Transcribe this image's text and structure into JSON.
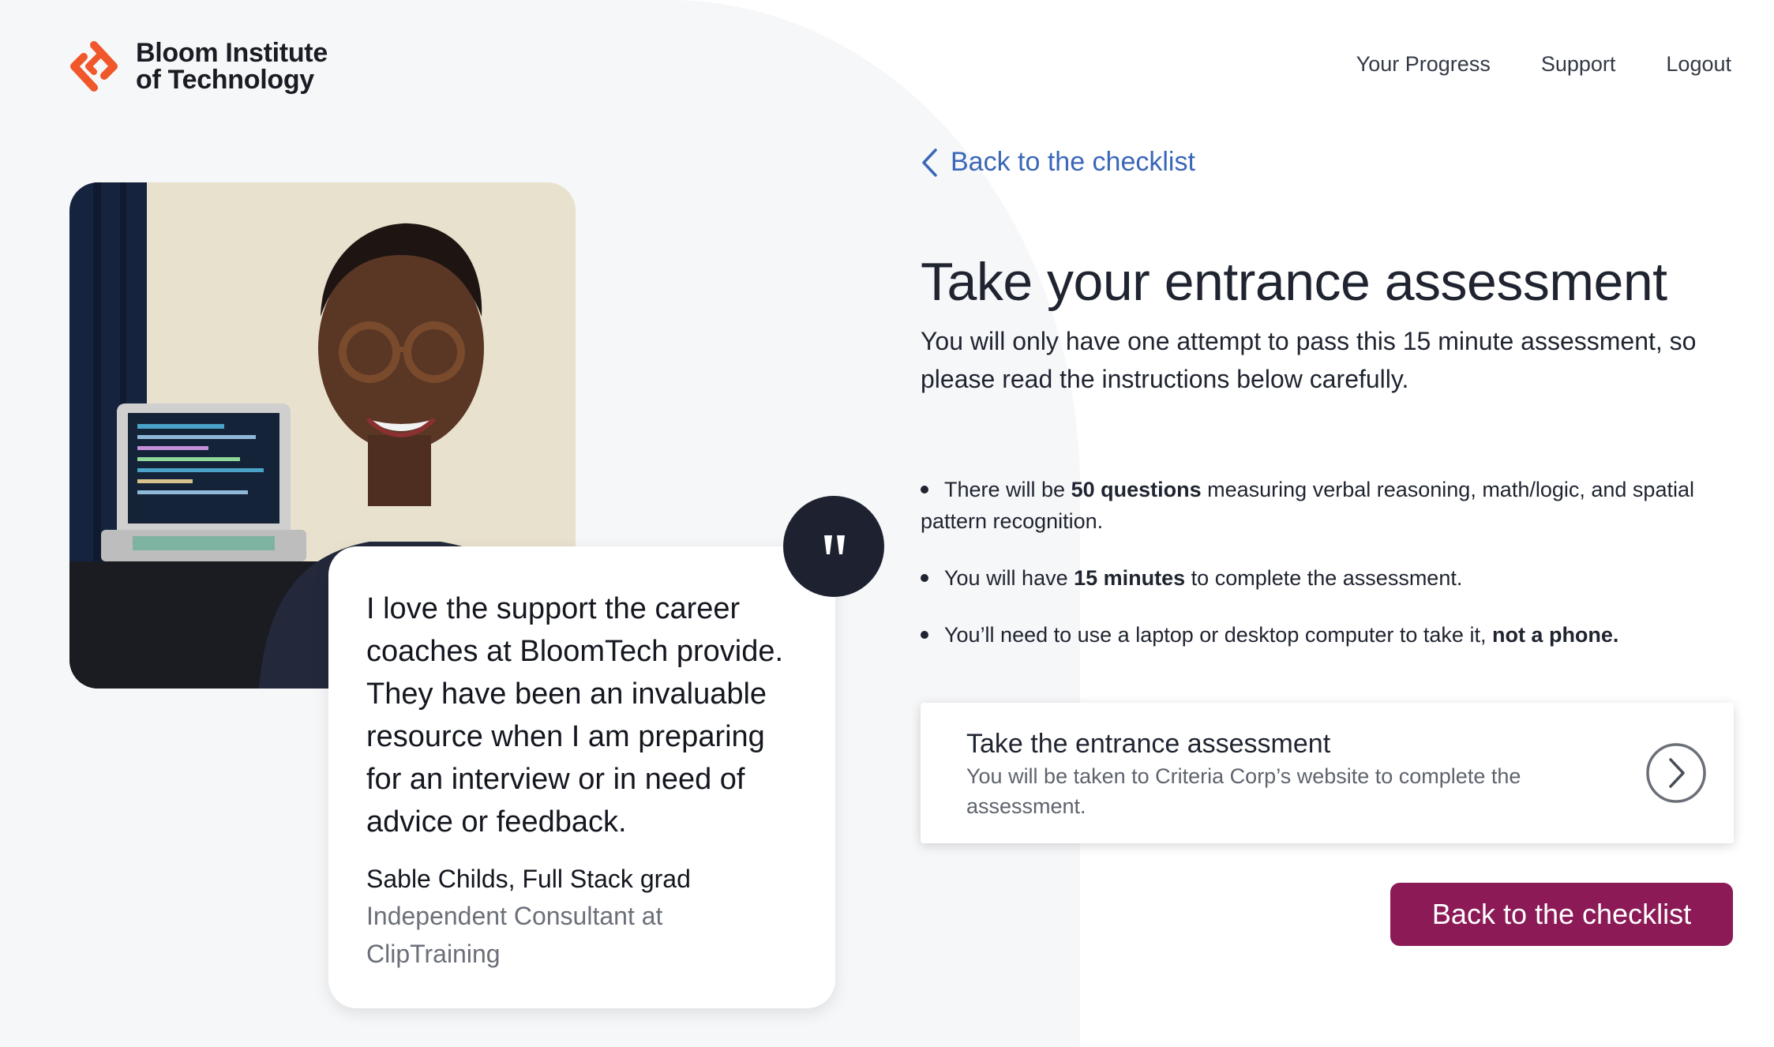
{
  "brand": {
    "name_line1": "Bloom Institute",
    "name_line2": "of Technology",
    "logo_icon": "bloomtech-logo-icon",
    "logo_color": "#F0572A"
  },
  "nav": {
    "items": [
      "Your Progress",
      "Support",
      "Logout"
    ]
  },
  "testimonial": {
    "quote": "I love the support the career coaches at BloomTech provide. They have been an invaluable resource when I am preparing for an interview or in need of advice or feedback.",
    "author": "Sable Childs, Full Stack grad",
    "role": "Independent Consultant at ClipTraining",
    "badge_icon": "quote-mark-icon",
    "badge_color": "#1E2230"
  },
  "main": {
    "back_link": "Back to the checklist",
    "title": "Take your entrance assessment",
    "subtitle": "You will only have one attempt to pass this 15 minute assessment, so please read the instructions below carefully.",
    "bullets": [
      {
        "pre": "There will be ",
        "bold": "50 questions",
        "post": " measuring verbal reasoning, math/logic, and spatial pattern recognition."
      },
      {
        "pre": "You will have ",
        "bold": "15 minutes",
        "post": " to complete the assessment."
      },
      {
        "pre": "You’ll need to use a laptop or desktop computer to take it, ",
        "bold": "not a phone.",
        "post": ""
      }
    ],
    "cta": {
      "title": "Take the entrance assessment",
      "description": "You will be taken to Criteria Corp’s website to complete the assessment.",
      "icon": "chevron-right-circle-icon"
    },
    "primary_button": "Back to the checklist",
    "primary_color": "#8B1A56",
    "link_color": "#3A67B8"
  }
}
